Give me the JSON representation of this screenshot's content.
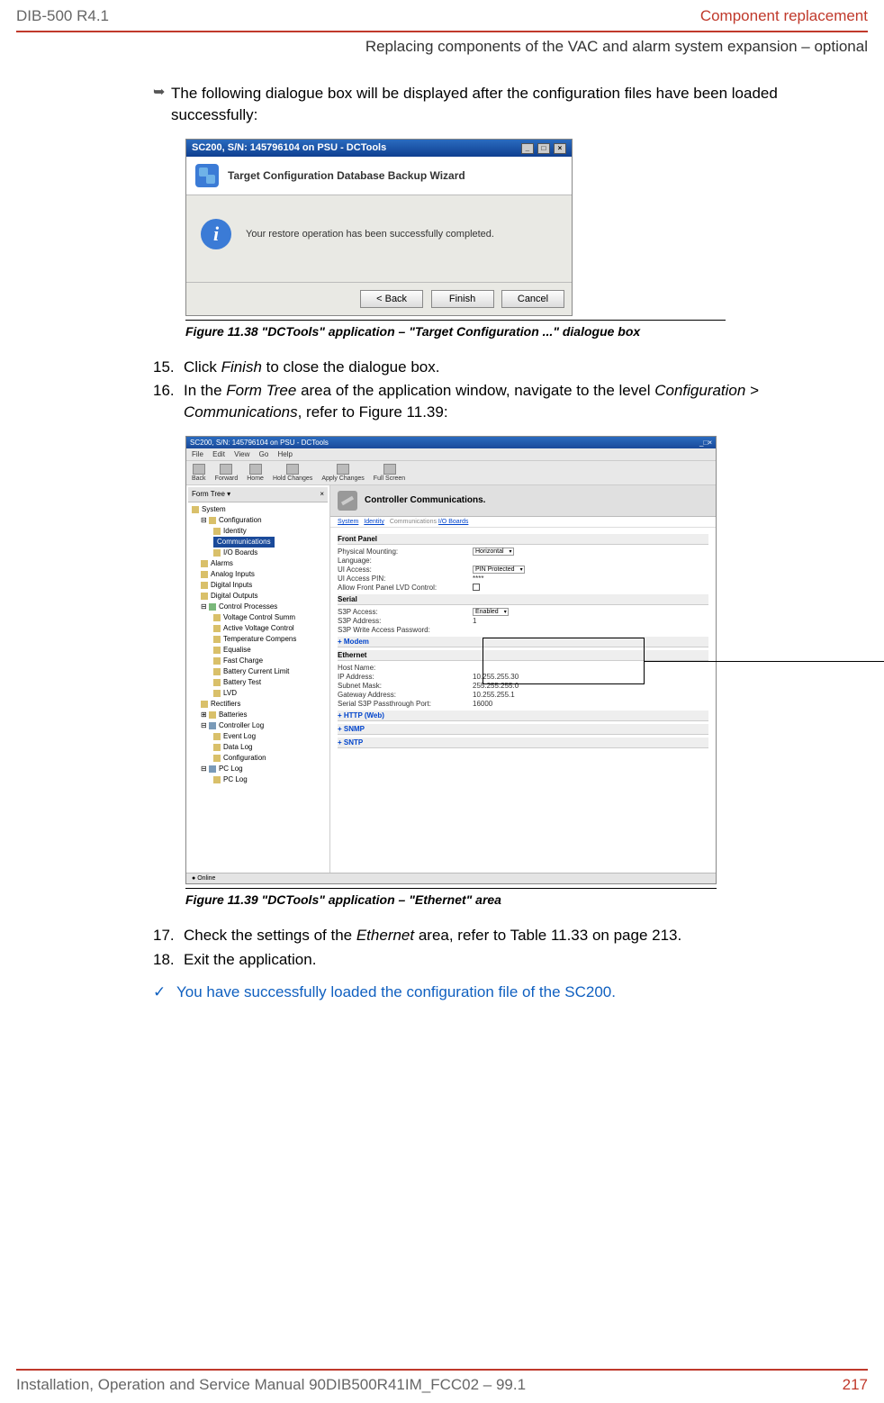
{
  "header": {
    "left": "DIB-500 R4.1",
    "right": "Component replacement",
    "sub": "Replacing components of the VAC and alarm system expansion – optional"
  },
  "para_arrow": "The following dialogue box will be displayed after the configuration files have been loaded successfully:",
  "dlg1": {
    "title": "SC200, S/N: 145796104 on PSU - DCTools",
    "banner": "Target Configuration Database Backup Wizard",
    "message": "Your restore operation has been successfully completed.",
    "btn_back": "<  Back",
    "btn_finish": "Finish",
    "btn_cancel": "Cancel"
  },
  "fig1_caption": "Figure 11.38 \"DCTools\" application – \"Target Configuration ...\" dialogue box",
  "step15": {
    "num": "15.",
    "txt_a": "Click ",
    "txt_i": "Finish",
    "txt_b": " to close the dialogue box."
  },
  "step16": {
    "num": "16.",
    "txt_a": "In the ",
    "txt_i1": "Form Tree",
    "txt_b": " area of the application window, navigate to the level ",
    "txt_i2": "Configuration",
    "txt_c": " > ",
    "txt_i3": "Communications",
    "txt_d": ", refer to Figure 11.39:"
  },
  "dlg2": {
    "title": "SC200, S/N: 145796104 on PSU - DCTools",
    "menu": {
      "file": "File",
      "edit": "Edit",
      "view": "View",
      "go": "Go",
      "help": "Help"
    },
    "toolbar": {
      "back": "Back",
      "forward": "Forward",
      "home": "Home",
      "hold": "Hold Changes",
      "apply": "Apply Changes",
      "full": "Full Screen"
    },
    "tree_header": "Form Tree  ▾",
    "tree": {
      "system": "System",
      "configuration": "Configuration",
      "identity": "Identity",
      "communications": "Communications",
      "io_boards": "I/O Boards",
      "alarms": "Alarms",
      "analog_inputs": "Analog Inputs",
      "digital_inputs": "Digital Inputs",
      "digital_outputs": "Digital Outputs",
      "control_processes": "Control Processes",
      "vcs": "Voltage Control Summ",
      "avc": "Active Voltage Control",
      "tc": "Temperature Compens",
      "eq": "Equalise",
      "fc": "Fast Charge",
      "bcl": "Battery Current Limit",
      "bt": "Battery Test",
      "lvd": "LVD",
      "rectifiers": "Rectifiers",
      "batteries": "Batteries",
      "controller_log": "Controller Log",
      "event_log": "Event Log",
      "data_log": "Data Log",
      "cfg2": "Configuration",
      "pc_log": "PC Log",
      "pc_log2": "PC Log"
    },
    "right": {
      "heading": "Controller Communications.",
      "crumbs": {
        "system": "System",
        "identity": "Identity",
        "comm": "Communications",
        "io": "I/O Boards"
      },
      "front_panel": "Front Panel",
      "pm_label": "Physical Mounting:",
      "pm_val": "Horizontal",
      "lang_label": "Language:",
      "ui_label": "UI Access:",
      "ui_val": "PIN Protected",
      "pin_label": "UI Access PIN:",
      "pin_val": "****",
      "lvd_label": "Allow Front Panel LVD Control:",
      "serial": "Serial",
      "s3p_access": "S3P Access:",
      "s3p_access_val": "Enabled",
      "s3p_addr": "S3P Address:",
      "s3p_addr_val": "1",
      "s3p_pw": "S3P Write Access Password:",
      "modem": "+ Modem",
      "ethernet": "Ethernet",
      "host": "Host Name:",
      "ip": "IP Address:",
      "ip_val": "10.255.255.30",
      "mask": "Subnet Mask:",
      "mask_val": "255.255.255.0",
      "gw": "Gateway Address:",
      "gw_val": "10.255.255.1",
      "s3p_port": "Serial S3P Passthrough Port:",
      "s3p_port_val": "16000",
      "http": "+ HTTP (Web)",
      "snmp": "+ SNMP",
      "sntp": "+ SNTP"
    },
    "status": "Online"
  },
  "fig2_caption": "Figure 11.39 \"DCTools\" application – \"Ethernet\" area",
  "step17": {
    "num": "17.",
    "txt_a": "Check the settings of the ",
    "txt_i": "Ethernet",
    "txt_b": " area, refer to Table 11.33 on page 213."
  },
  "step18": {
    "num": "18.",
    "txt": "Exit the application."
  },
  "success": "You have successfully loaded the configuration file of the SC200.",
  "footer": {
    "left": "Installation, Operation and Service Manual 90DIB500R41IM_FCC02  –  99.1",
    "right": "217"
  }
}
